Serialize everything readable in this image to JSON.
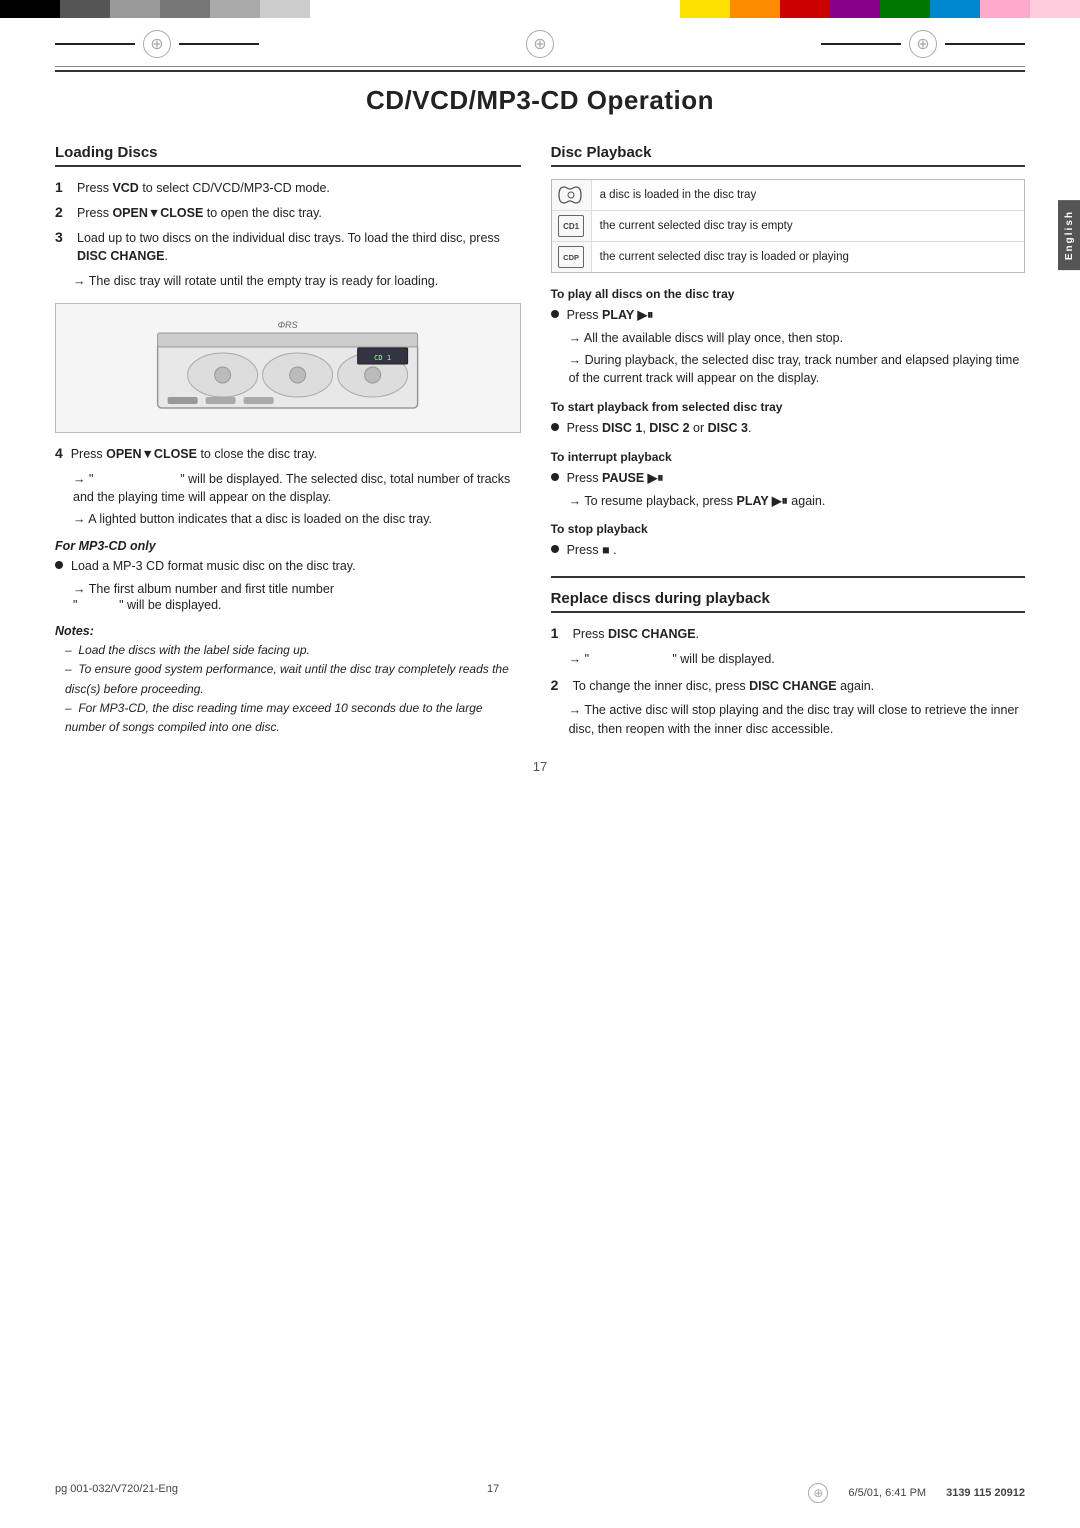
{
  "page": {
    "title": "CD/VCD/MP3-CD Operation",
    "number": "17",
    "footer_left": "pg 001-032/V720/21-Eng",
    "footer_center": "17",
    "footer_date": "6/5/01, 6:41 PM",
    "footer_code": "3139 115 20912"
  },
  "sidebar": {
    "label": "English"
  },
  "loading_discs": {
    "heading": "Loading Discs",
    "steps": [
      {
        "num": "1",
        "text": "Press ",
        "bold_text": "VCD",
        "text2": " to select CD/VCD/MP3-CD mode."
      },
      {
        "num": "2",
        "text": "Press ",
        "bold_text": "OPEN▼CLOSE",
        "text2": " to open the disc tray."
      },
      {
        "num": "3",
        "text": "Load up to two discs on the individual disc trays. To load the third disc, press ",
        "bold_text": "DISC CHANGE",
        "text2": ".",
        "arrow": "The disc tray will rotate until the empty tray is ready for loading."
      }
    ],
    "step4_text": "Press ",
    "step4_bold": "OPEN▼CLOSE",
    "step4_text2": " to close the disc tray.",
    "step4_arrow1": "“                                ” will be displayed. The selected disc, total number of tracks and the playing time will appear on the display.",
    "step4_arrow2": "A lighted button indicates that a disc is loaded on the disc tray.",
    "mp3_heading": "For MP3-CD only",
    "mp3_bullet": "Load a MP-3 CD format music disc on the disc tray.",
    "mp3_arrow1": "The first album number and first title number",
    "mp3_arrow2": "“          ” will be displayed.",
    "notes_label": "Notes:",
    "notes": [
      "–  Load the discs with the label side facing up.",
      "–  To ensure good system performance, wait until the disc tray completely reads the disc(s) before proceeding.",
      "–  For MP3-CD, the disc reading time may exceed 10 seconds due to the large number of songs compiled into one disc."
    ]
  },
  "disc_playback": {
    "heading": "Disc Playback",
    "icons": [
      {
        "icon_label": "",
        "icon_type": "cd_empty",
        "description": "a disc is loaded in the disc tray"
      },
      {
        "icon_label": "CD1",
        "icon_type": "cd1",
        "description": "the current selected disc tray is empty"
      },
      {
        "icon_label": "CDP",
        "icon_type": "cdp",
        "description": "the current selected disc tray is loaded or playing"
      }
    ],
    "play_all_heading": "To play all discs on the disc tray",
    "play_all_bullet": "Press ",
    "play_all_bold": "PLAY ►‖",
    "play_all_arrow1": "All the available discs will play once, then stop.",
    "play_all_arrow2": "During playback, the selected disc tray, track number and elapsed playing time of the current track will appear on the display.",
    "start_selected_heading": "To start playback from selected disc tray",
    "start_selected_bullet": "Press ",
    "start_selected_bold": "DISC 1",
    "start_selected_text2": ", ",
    "start_selected_bold2": "DISC 2",
    "start_selected_text3": " or ",
    "start_selected_bold3": "DISC 3",
    "start_selected_end": ".",
    "interrupt_heading": "To interrupt playback",
    "interrupt_bullet": "Press ",
    "interrupt_bold": "PAUSE ►‖",
    "interrupt_arrow": "To resume playback, press ",
    "interrupt_arrow_bold": "PLAY ►‖",
    "interrupt_arrow_end": " again.",
    "stop_heading": "To stop playback",
    "stop_bullet_prefix": "Press ",
    "stop_bullet_bold": "■",
    "stop_bullet_end": "."
  },
  "replace_discs": {
    "heading": "Replace discs during playback",
    "step1_text": "Press ",
    "step1_bold": "DISC CHANGE",
    "step1_end": ".",
    "step1_arrow": "“                                ” will be displayed.",
    "step2_text": "To change the inner disc, press ",
    "step2_bold": "DISC CHANGE",
    "step2_end": " again.",
    "step2_arrow": "The active disc will stop playing and the disc tray will close to retrieve the inner disc, then reopen with the inner disc accessible."
  },
  "colors": {
    "top_bar_left": [
      "#000",
      "#555",
      "#aaa",
      "#777",
      "#aaa",
      "#ccc"
    ],
    "top_bar_right": [
      "#ffcc00",
      "#f90",
      "#cc0000",
      "#990099",
      "#009900",
      "#33aaff",
      "#ffaacc",
      "#ffccdd"
    ],
    "accent": "#222"
  }
}
